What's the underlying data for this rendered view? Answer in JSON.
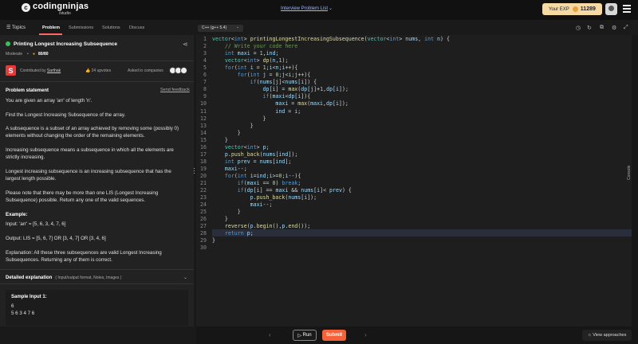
{
  "header": {
    "logo_letter": "c",
    "logo_text": "codingninjas",
    "logo_sub": "/studio",
    "problem_list": "Interview Problem List",
    "exp_label": "Your EXP",
    "exp_value": "11289"
  },
  "subbar": {
    "topics": "Topics",
    "tabs": [
      "Problem",
      "Submissions",
      "Solutions",
      "Discuss"
    ]
  },
  "problem": {
    "title": "Printing Longest Increasing Subsequence",
    "difficulty": "Moderate",
    "score": "80/80",
    "author_initial": "S",
    "contributed_prefix": "Contributed by",
    "author": "Sarthak",
    "upvotes": "24 upvotes",
    "asked_in": "Asked in companies",
    "statement_title": "Problem statement",
    "send_feedback": "Send feedback",
    "paragraphs": [
      "You are given an array 'arr' of length 'n'.",
      "Find the Longest Increasing Subsequence of the array.",
      "A subsequence is a subset of an array achieved by removing some (possibly 0) elements without changing the order of the remaining elements.",
      "Increasing subsequence means a subsequence in which all the elements are strictly increasing.",
      "Longest increasing subsequence is an increasing subsequence that has the largest length possible.",
      "Please note that there may be more than one LIS (Longest Increasing Subsequence) possible. Return any one of the valid sequences.",
      "Example:",
      "Input: 'arr' = [5, 6, 3, 4, 7, 6]",
      "Output: LIS = [5, 6, 7] OR [3, 4, 7] OR [3, 4, 6]",
      "Explanation: All these three subsequences are valid Longest Increasing Subsequences. Returning any of them is correct."
    ],
    "detailed_title": "Detailed explanation",
    "detailed_sub": "( Input/output format, Notes, Images )",
    "sample_title": "Sample Input 1:",
    "sample_lines": [
      "6",
      "5 6 3 4 7 6"
    ]
  },
  "editor": {
    "language": "C++ (g++ 5.4)",
    "line_numbers": [
      "1",
      "2",
      "3",
      "4",
      "5",
      "6",
      "7",
      "8",
      "9",
      "10",
      "11",
      "12",
      "13",
      "14",
      "15",
      "16",
      "17",
      "18",
      "19",
      "20",
      "21",
      "22",
      "23",
      "24",
      "25",
      "26",
      "27",
      "28",
      "29",
      "30"
    ]
  },
  "sidebar": {
    "console": "Console"
  },
  "bottom": {
    "run": "Run",
    "submit": "Submit",
    "view_approaches": "View approaches"
  },
  "colors": {
    "accent": "#f4623a",
    "exp_bg": "#f7d9a4",
    "success": "#3cbf5a",
    "link": "#9db7ff"
  }
}
